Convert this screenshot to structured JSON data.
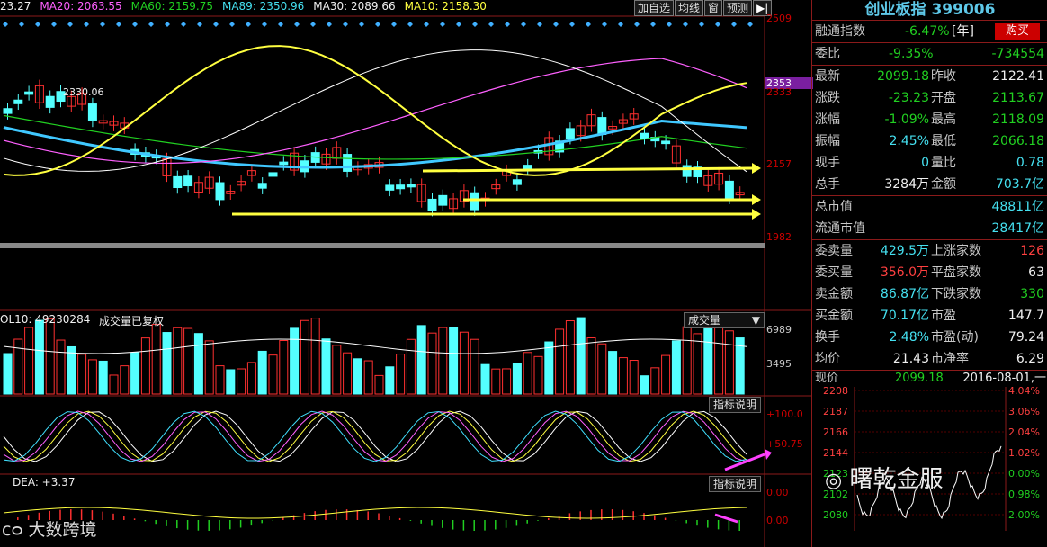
{
  "ma_bar": {
    "ma5": "23.27",
    "ma20": "MA20: 2063.55",
    "ma60": "MA60: 2159.75",
    "ma89": "MA89: 2350.96",
    "ma30": "MA30: 2089.66",
    "ma10": "MA10: 2158.30"
  },
  "toolbar": {
    "add_watch": "加自选",
    "ma_line": "均线",
    "window": "窗",
    "forecast": "预测"
  },
  "price_axis": {
    "top": "2509",
    "current_tag": "2353",
    "l2333": "2333",
    "l2157": "2157",
    "l1982": "1982"
  },
  "price_annotation": "2330.06",
  "vol": {
    "label": "OL10: 49230284",
    "restored": "成交量已复权",
    "selector": "成交量",
    "top": "6989",
    "mid": "3495",
    "help": "指标说明"
  },
  "ind1": {
    "top": "+100.0",
    "mid": "+50.75"
  },
  "ind2": {
    "label": "DEA: +3.37",
    "help": "指标说明",
    "top": "0.00",
    "mid": "0.00"
  },
  "right_panel": {
    "title": "创业板指 399006",
    "rows": [
      {
        "l1": "融通指数",
        "v1": "-6.47%",
        "v1x": "[年]",
        "buy": "购买"
      },
      {
        "l1": "委比",
        "v1": "-9.35%",
        "v2": "-734554"
      },
      {
        "l1": "最新",
        "v1": "2099.18",
        "l2": "昨收",
        "v2": "2122.41"
      },
      {
        "l1": "涨跌",
        "v1": "-23.23",
        "l2": "开盘",
        "v2": "2113.67"
      },
      {
        "l1": "涨幅",
        "v1": "-1.09%",
        "l2": "最高",
        "v2": "2118.09"
      },
      {
        "l1": "振幅",
        "v1": "2.45%",
        "l2": "最低",
        "v2": "2066.18"
      },
      {
        "l1": "现手",
        "v1": "0",
        "l2": "量比",
        "v2": "0.78"
      },
      {
        "l1": "总手",
        "v1": "3284万",
        "l2": "金额",
        "v2": "703.7亿"
      }
    ],
    "mcap": [
      {
        "l": "总市值",
        "v": "48811亿"
      },
      {
        "l": "流通市值",
        "v": "28417亿"
      }
    ],
    "stats": [
      {
        "l1": "委卖量",
        "v1": "429.5万",
        "l2": "上涨家数",
        "v2": "126"
      },
      {
        "l1": "委买量",
        "v1": "356.0万",
        "l2": "平盘家数",
        "v2": "63"
      },
      {
        "l1": "卖金额",
        "v1": "86.87亿",
        "l2": "下跌家数",
        "v2": "330"
      },
      {
        "l1": "买金额",
        "v1": "70.17亿",
        "l2": "市盈",
        "v2": "147.7"
      },
      {
        "l1": "换手",
        "v1": "2.48%",
        "l2": "市盈(动)",
        "v2": "79.24"
      },
      {
        "l1": "均价",
        "v1": "21.43",
        "l2": "市净率",
        "v2": "6.29"
      }
    ],
    "mini": {
      "price_label": "现价",
      "price": "2099.18",
      "date": "2016-08-01,一",
      "left_ticks": [
        "2208",
        "2187",
        "2166",
        "2144",
        "2123",
        "2102",
        "2080"
      ],
      "right_ticks": [
        "4.04%",
        "3.06%",
        "2.04%",
        "1.02%",
        "0.00%",
        "0.98%",
        "2.00%"
      ]
    }
  },
  "watermark": {
    "brand": "曙乾金服",
    "corner": "大数跨境"
  },
  "colors": {
    "up": "#ff3030",
    "down": "#54ffff",
    "ma_yellow": "#ffff40",
    "ma_cyan": "#40c8ff",
    "ma_pink": "#ff60ff",
    "frame": "#8b1a1a"
  }
}
